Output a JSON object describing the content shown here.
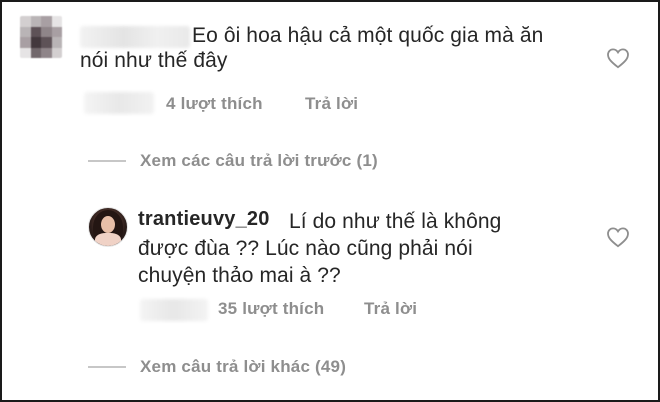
{
  "comment": {
    "text_line1": "Eo ôi hoa hậu cả một quốc gia mà ăn",
    "text_line2": "nói như thế đây",
    "likes": "4 lượt thích",
    "reply_label": "Trả lời"
  },
  "view_previous_replies": "Xem các câu trả lời trước (1)",
  "reply": {
    "username": "trantieuvy_20",
    "text_line1": "Lí do như thế là không",
    "text_line2": "được đùa ?? Lúc nào cũng phải nói",
    "text_line3": "chuyện thảo mai à ??",
    "likes": "35 lượt thích",
    "reply_label": "Trả lời"
  },
  "view_other_replies": "Xem câu trả lời khác (49)",
  "icons": {
    "like": "heart-outline-icon"
  },
  "colors": {
    "text": "#262626",
    "secondary": "#8e8e8e",
    "divider": "#c7c7c7"
  }
}
